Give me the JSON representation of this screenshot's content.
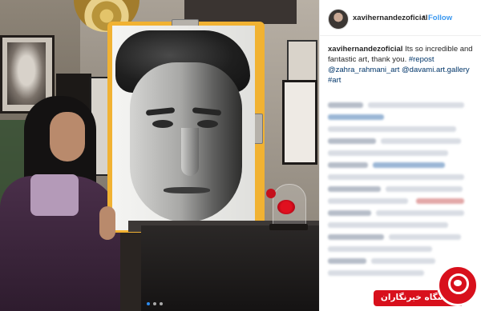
{
  "post": {
    "username": "xavihernandezoficial",
    "separator": "•",
    "follow_label": "Follow"
  },
  "caption": {
    "username": "xavihernandezoficial",
    "text": " Its so incredible and fantastic art, thank you. ",
    "tags": [
      "#repost",
      "@zahra_rahmani_art",
      "@davami.art.gallery",
      "#art"
    ]
  },
  "carousel": {
    "count": 3,
    "active": 0
  },
  "overlay": {
    "brand_text": "باشگاه خبرنگاران"
  },
  "colors": {
    "link": "#3897f0",
    "tag": "#003569",
    "brand_red": "#d8101c"
  }
}
